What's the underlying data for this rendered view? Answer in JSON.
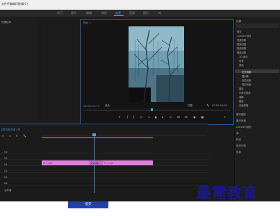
{
  "menubar": {
    "items": [
      "文件(F)",
      "编辑(E)",
      "剪辑(C)",
      "序列(S)",
      "标记(M)",
      "图形(G)",
      "视图(V)",
      "窗口(W)",
      "帮助(H)"
    ]
  },
  "workspace": {
    "tabs": [
      "学习",
      "组件",
      "编辑",
      "颜色",
      "效果",
      "音频",
      "图形",
      "库"
    ],
    "active_tab": "效果"
  },
  "source_panel": {
    "title": "效果控件"
  },
  "program_monitor": {
    "title": "节目: 1",
    "timecode": "00:00:04:19",
    "fit_label": "适合",
    "quality_label": "完整",
    "duration": "00:00:20:00"
  },
  "effects_panel": {
    "title": "效果",
    "tree": [
      "预设",
      "Lumetri 预设",
      "音频效果",
      "音频过渡",
      "视频效果",
      "视频过渡",
      "3D 运动",
      "内滑",
      "划像",
      "交叉划像",
      "圆划像",
      "盒形划像",
      "菱形划像",
      "擦除",
      "沉浸式视频",
      "溶解",
      "缩放",
      "页面剥落"
    ],
    "selected_item": "交叉划像",
    "sections": [
      "基本图形",
      "基本声音",
      "Lumetri 颜色",
      "库",
      "标记",
      "历史记录",
      "信息"
    ]
  },
  "timeline": {
    "timecode": "00:00:04:19",
    "clip_label_1": "fx 7.mp4",
    "clip_label_2": "交叉划像",
    "clip_label_3": "fx 7.mp4",
    "tracks": [
      "V3",
      "V2",
      "V1",
      "A1",
      "A2",
      "A3",
      "主声道"
    ]
  },
  "bottom": {
    "submit_label": "提交"
  },
  "watermark": {
    "text": "最需教育"
  },
  "colors": {
    "accent": "#4a9de8",
    "clip": "#e07fe0",
    "submit": "#2241a8",
    "watermark": "#1a1a8c"
  }
}
